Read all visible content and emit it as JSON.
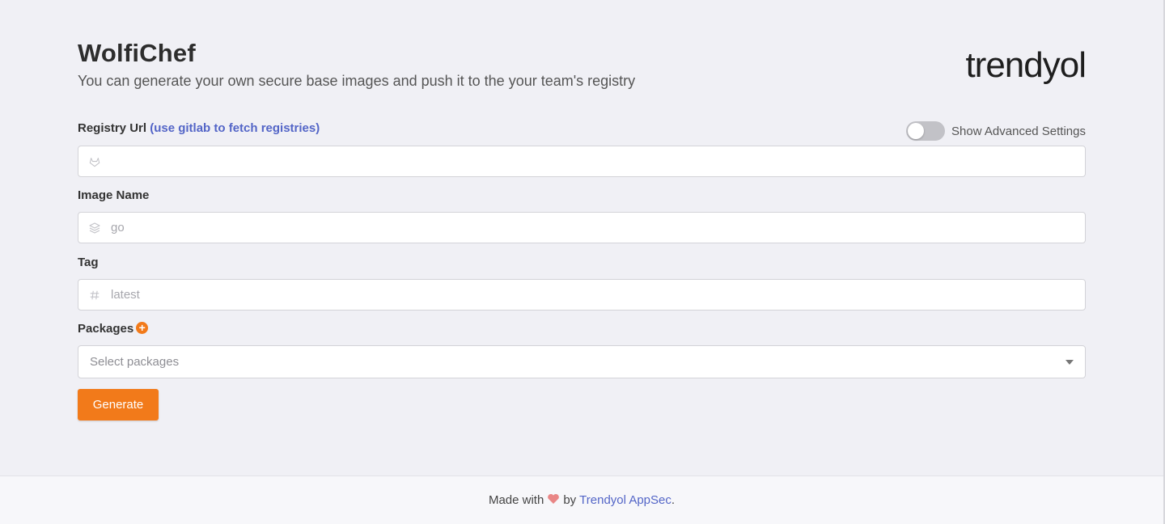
{
  "header": {
    "title": "WolfiChef",
    "subtitle": "You can generate your own secure base images and push it to the your team's registry",
    "brand": "trendyol"
  },
  "form": {
    "registry": {
      "label": "Registry Url",
      "link_text": "(use gitlab to fetch registries)",
      "value": "",
      "icon": "gitlab-icon"
    },
    "advanced": {
      "label": "Show Advanced Settings",
      "enabled": false
    },
    "image_name": {
      "label": "Image Name",
      "placeholder": "go",
      "icon": "layers-icon"
    },
    "tag": {
      "label": "Tag",
      "placeholder": "latest",
      "icon": "hash-icon"
    },
    "packages": {
      "label": "Packages",
      "placeholder": "Select packages",
      "add_icon": "plus-circle-icon"
    },
    "generate_label": "Generate"
  },
  "footer": {
    "prefix": "Made with",
    "by": "by",
    "link": "Trendyol AppSec",
    "suffix": "."
  },
  "colors": {
    "accent": "#f27a1a",
    "link": "#5365c7",
    "background": "#f0f0f5"
  }
}
